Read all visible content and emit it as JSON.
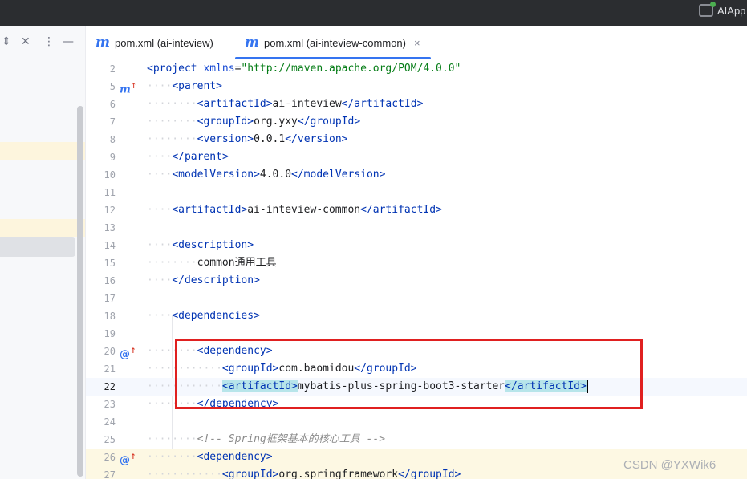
{
  "app": {
    "name": "AIApp"
  },
  "left_panel": {
    "tools": [
      "⇕",
      "✕",
      "⋮",
      "—"
    ]
  },
  "tabs": [
    {
      "label": "pom.xml (ai-inteview)",
      "active": false
    },
    {
      "label": "pom.xml (ai-inteview-common)",
      "active": true,
      "close": "×"
    }
  ],
  "editor": {
    "current_line": 22,
    "lines": [
      {
        "num": "2",
        "text": "<project xmlns=\"http://maven.apache.org/POM/4.0.0\""
      },
      {
        "num": "5",
        "text": "····<parent>",
        "icon": "m↑"
      },
      {
        "num": "6",
        "text": "········<artifactId>ai-inteview</artifactId>"
      },
      {
        "num": "7",
        "text": "········<groupId>org.yxy</groupId>"
      },
      {
        "num": "8",
        "text": "········<version>0.0.1</version>"
      },
      {
        "num": "9",
        "text": "····</parent>"
      },
      {
        "num": "10",
        "text": "····<modelVersion>4.0.0</modelVersion>"
      },
      {
        "num": "11",
        "text": ""
      },
      {
        "num": "12",
        "text": "····<artifactId>ai-inteview-common</artifactId>"
      },
      {
        "num": "13",
        "text": ""
      },
      {
        "num": "14",
        "text": "····<description>"
      },
      {
        "num": "15",
        "text": "········common通用工具"
      },
      {
        "num": "16",
        "text": "····</description>"
      },
      {
        "num": "17",
        "text": ""
      },
      {
        "num": "18",
        "text": "····<dependencies>"
      },
      {
        "num": "19",
        "text": ""
      },
      {
        "num": "20",
        "text": "········<dependency>",
        "icon": "@↑"
      },
      {
        "num": "21",
        "text": "············<groupId>com.baomidou</groupId>"
      },
      {
        "num": "22",
        "text": "············<artifactId>mybatis-plus-spring-boot3-starter</artifactId>"
      },
      {
        "num": "23",
        "text": "········</dependency>"
      },
      {
        "num": "24",
        "text": ""
      },
      {
        "num": "25",
        "text": "········<!-- Spring框架基本的核心工具 -->"
      },
      {
        "num": "26",
        "text": "········<dependency>",
        "icon": "@↑"
      },
      {
        "num": "27",
        "text": "············<groupId>org.springframework</groupId>"
      }
    ]
  },
  "watermark": "CSDN @YXWik6"
}
